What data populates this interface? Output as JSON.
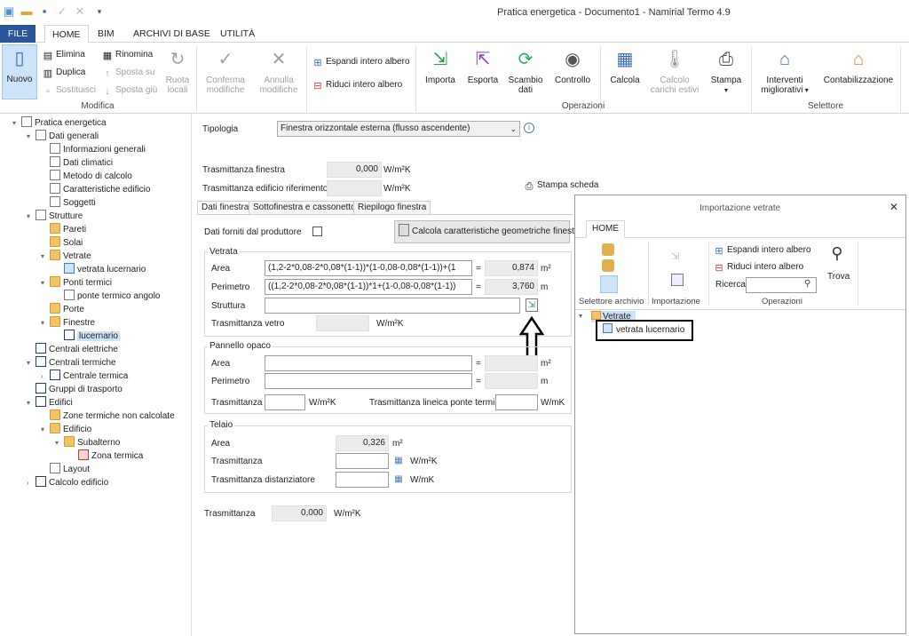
{
  "window": {
    "title": "Pratica energetica - Documento1 - Namirial Termo 4.9"
  },
  "ribbon_tabs": [
    "FILE",
    "HOME",
    "BIM",
    "ARCHIVI DI BASE",
    "UTILITÀ"
  ],
  "ribbon": {
    "nuovo": "Nuovo",
    "elimina": "Elimina",
    "duplica": "Duplica",
    "sostituisci": "Sostituisci",
    "rinomina": "Rinomina",
    "sposta_su": "Sposta su",
    "sposta_giu": "Sposta giù",
    "ruota_1": "Ruota",
    "ruota_2": "locali",
    "conferma_1": "Conferma",
    "conferma_2": "modifiche",
    "annulla_1": "Annulla",
    "annulla_2": "modifiche",
    "espandi": "Espandi intero albero",
    "riduci": "Riduci intero albero",
    "importa": "Importa",
    "esporta": "Esporta",
    "scambio_1": "Scambio",
    "scambio_2": "dati",
    "controllo": "Controllo",
    "calcola": "Calcola",
    "carichi_1": "Calcolo",
    "carichi_2": "carichi estivi",
    "stampa": "Stampa",
    "interventi_1": "Interventi",
    "interventi_2": "migliorativi",
    "contabilizzazione": "Contabilizzazione",
    "grp_modifica": "Modifica",
    "grp_operazioni": "Operazioni",
    "grp_selettore": "Selettore"
  },
  "tree": [
    {
      "label": "Pratica energetica"
    },
    {
      "label": "Dati generali"
    },
    {
      "label": "Informazioni generali"
    },
    {
      "label": "Dati climatici"
    },
    {
      "label": "Metodo di calcolo"
    },
    {
      "label": "Caratteristiche edificio"
    },
    {
      "label": "Soggetti"
    },
    {
      "label": "Strutture"
    },
    {
      "label": "Pareti"
    },
    {
      "label": "Solai"
    },
    {
      "label": "Vetrate"
    },
    {
      "label": "vetrata lucernario"
    },
    {
      "label": "Ponti termici"
    },
    {
      "label": "ponte termico angolo"
    },
    {
      "label": "Porte"
    },
    {
      "label": "Finestre"
    },
    {
      "label": "lucernario"
    },
    {
      "label": "Centrali elettriche"
    },
    {
      "label": "Centrali termiche"
    },
    {
      "label": "Centrale termica"
    },
    {
      "label": "Gruppi di trasporto"
    },
    {
      "label": "Edifici"
    },
    {
      "label": "Zone termiche non calcolate"
    },
    {
      "label": "Edificio"
    },
    {
      "label": "Subalterno"
    },
    {
      "label": "Zona termica"
    },
    {
      "label": "Layout"
    },
    {
      "label": "Calcolo edificio"
    }
  ],
  "form": {
    "tipologia_label": "Tipologia",
    "tipologia_value": "Finestra orizzontale esterna (flusso ascendente)",
    "trasm_finestra_label": "Trasmittanza finestra",
    "trasm_finestra_value": "0,000",
    "unit_wm2k": "W/m²K",
    "trasm_rif_label": "Trasmittanza edificio riferimento",
    "stampa_scheda": "Stampa scheda",
    "tabs": [
      "Dati finestra",
      "Sottofinestra e cassonetto",
      "Riepilogo finestra"
    ],
    "dati_produttore": "Dati forniti dal produttore",
    "calcola_btn": "Calcola caratteristiche geometriche finestra",
    "vetrata": {
      "title": "Vetrata",
      "area_label": "Area",
      "area_formula": "(1,2-2*0,08-2*0,08*(1-1))*(1-0,08-0,08*(1-1))+(1",
      "area_value": "0,874",
      "area_unit": "m²",
      "perimetro_label": "Perimetro",
      "perimetro_formula": "((1,2-2*0,08-2*0,08*(1-1))*1+(1-0,08-0,08*(1-1))",
      "perimetro_value": "3,760",
      "perimetro_unit": "m",
      "struttura_label": "Struttura",
      "trasm_vetro_label": "Trasmittanza vetro"
    },
    "pannello": {
      "title": "Pannello opaco",
      "area_label": "Area",
      "perimetro_label": "Perimetro",
      "trasm_label": "Trasmittanza",
      "lineica_label": "Trasmittanza lineica ponte termico",
      "unit_m2": "m²",
      "unit_m": "m",
      "unit_wmk": "W/mK"
    },
    "telaio": {
      "title": "Telaio",
      "area_label": "Area",
      "area_value": "0,326",
      "area_unit": "m²",
      "trasm_label": "Trasmittanza",
      "trasm_dist_label": "Trasmittanza distanziatore",
      "unit_wmk": "W/mK"
    },
    "trasm_label": "Trasmittanza",
    "trasm_value": "0,000",
    "equals": "="
  },
  "import_panel": {
    "title": "Importazione vetrate",
    "tab": "HOME",
    "grp_selettore": "Selettore archivio",
    "grp_importazione": "Importazione",
    "grp_operazioni": "Operazioni",
    "espandi": "Espandi intero albero",
    "riduci": "Riduci intero albero",
    "ricerca": "Ricerca",
    "trova": "Trova",
    "tree_root": "Vetrate",
    "tree_item": "vetrata lucernario"
  }
}
